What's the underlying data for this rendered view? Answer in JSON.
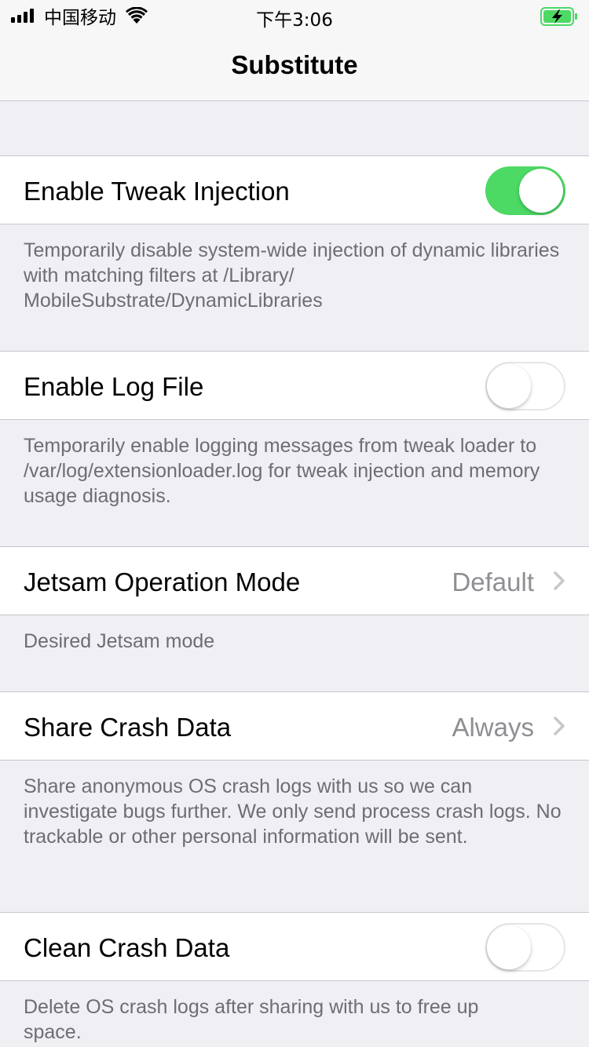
{
  "status_bar": {
    "carrier": "中国移动",
    "time": "下午3:06",
    "icons": [
      "signal-icon",
      "wifi-icon",
      "battery-charging-icon"
    ]
  },
  "nav": {
    "title": "Substitute"
  },
  "rows": [
    {
      "label": "Enable Tweak Injection",
      "control": "toggle",
      "state": "on",
      "footer": "Temporarily disable system-wide injection of dynamic libraries with matching filters at /Library/ MobileSubstrate/DynamicLibraries"
    },
    {
      "label": "Enable Log File",
      "control": "toggle",
      "state": "off",
      "footer": "Temporarily enable logging messages from tweak loader to /var/log/extensionloader.log for tweak injection and memory usage diagnosis."
    },
    {
      "label": "Jetsam Operation Mode",
      "control": "disclosure",
      "value": "Default",
      "footer": "Desired Jetsam mode"
    },
    {
      "label": "Share Crash Data",
      "control": "disclosure",
      "value": "Always",
      "footer": "Share anonymous OS crash logs with us so we can investigate bugs further. We only send process crash logs. No trackable or other personal information will be sent."
    },
    {
      "label": "Clean Crash Data",
      "control": "toggle",
      "state": "off",
      "footer": "Delete OS crash logs after sharing with us to free up space."
    }
  ],
  "colors": {
    "toggle_on": "#4cd964",
    "background": "#efeff4",
    "secondary_text": "#6d6d72",
    "value_text": "#8e8e93"
  }
}
